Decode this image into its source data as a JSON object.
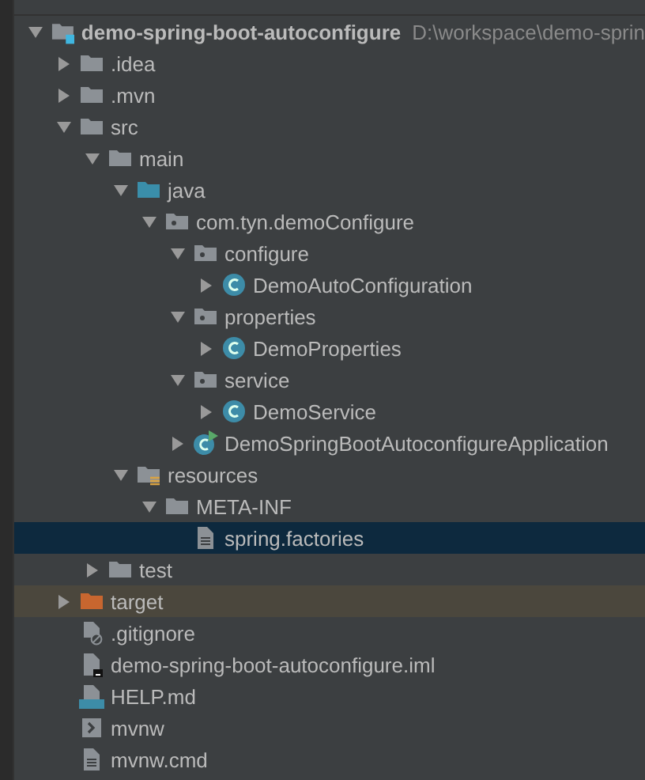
{
  "tree": [
    {
      "name": "demo-spring-boot-autoconfigure",
      "path": "D:\\workspace\\demo-sprin",
      "kind": "module",
      "expanded": true,
      "selected": false,
      "children": [
        {
          "name": ".idea",
          "kind": "folder",
          "expanded": false,
          "selected": false
        },
        {
          "name": ".mvn",
          "kind": "folder",
          "expanded": false,
          "selected": false
        },
        {
          "name": "src",
          "kind": "folder",
          "expanded": true,
          "selected": false,
          "children": [
            {
              "name": "main",
              "kind": "folder",
              "expanded": true,
              "selected": false,
              "children": [
                {
                  "name": "java",
                  "kind": "source-folder",
                  "expanded": true,
                  "selected": false,
                  "children": [
                    {
                      "name": "com.tyn.demoConfigure",
                      "kind": "package",
                      "expanded": true,
                      "selected": false,
                      "children": [
                        {
                          "name": "configure",
                          "kind": "package",
                          "expanded": true,
                          "selected": false,
                          "children": [
                            {
                              "name": "DemoAutoConfiguration",
                              "kind": "class",
                              "expanded": false,
                              "selected": false
                            }
                          ]
                        },
                        {
                          "name": "properties",
                          "kind": "package",
                          "expanded": true,
                          "selected": false,
                          "children": [
                            {
                              "name": "DemoProperties",
                              "kind": "class",
                              "expanded": false,
                              "selected": false
                            }
                          ]
                        },
                        {
                          "name": "service",
                          "kind": "package",
                          "expanded": true,
                          "selected": false,
                          "children": [
                            {
                              "name": "DemoService",
                              "kind": "class",
                              "expanded": false,
                              "selected": false
                            }
                          ]
                        },
                        {
                          "name": "DemoSpringBootAutoconfigureApplication",
                          "kind": "app-class",
                          "expanded": false,
                          "selected": false
                        }
                      ]
                    }
                  ]
                },
                {
                  "name": "resources",
                  "kind": "resources-folder",
                  "expanded": true,
                  "selected": false,
                  "children": [
                    {
                      "name": "META-INF",
                      "kind": "folder",
                      "expanded": true,
                      "selected": false,
                      "children": [
                        {
                          "name": "spring.factories",
                          "kind": "text-file",
                          "selected": true
                        }
                      ]
                    }
                  ]
                }
              ]
            },
            {
              "name": "test",
              "kind": "folder",
              "expanded": false,
              "selected": false
            }
          ]
        },
        {
          "name": "target",
          "kind": "excluded-folder",
          "expanded": false,
          "selected": false
        },
        {
          "name": ".gitignore",
          "kind": "ignore-file",
          "selected": false
        },
        {
          "name": "demo-spring-boot-autoconfigure.iml",
          "kind": "iml-file",
          "selected": false
        },
        {
          "name": "HELP.md",
          "kind": "md-file",
          "selected": false
        },
        {
          "name": "mvnw",
          "kind": "script-file",
          "selected": false
        },
        {
          "name": "mvnw.cmd",
          "kind": "text-file",
          "selected": false
        }
      ]
    }
  ]
}
